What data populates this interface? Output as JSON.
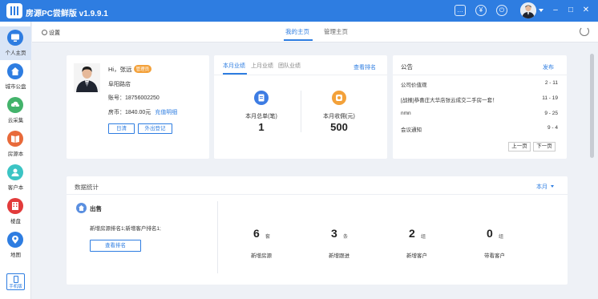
{
  "app": {
    "title": "房源PC尝鲜版 v1.9.9.1"
  },
  "sidebar": {
    "items": [
      {
        "label": "个人主页",
        "icon": "monitor-icon",
        "color": "#2e7de1"
      },
      {
        "label": "城市公盘",
        "icon": "house-icon",
        "color": "#2e7de1"
      },
      {
        "label": "云采集",
        "icon": "cloud-download-icon",
        "color": "#43b36b"
      },
      {
        "label": "房源本",
        "icon": "book-icon",
        "color": "#e86a3a"
      },
      {
        "label": "客户本",
        "icon": "person-icon",
        "color": "#3cc4c4"
      },
      {
        "label": "楼盘",
        "icon": "building-icon",
        "color": "#e23b3b"
      },
      {
        "label": "地图",
        "icon": "location-icon",
        "color": "#2e7de1"
      }
    ],
    "phone_label": "手机版"
  },
  "tabbar": {
    "settings": "设置",
    "tabs": [
      "我的主页",
      "管理主页"
    ],
    "active_tab": "我的主页"
  },
  "profile": {
    "greeting": "Hi，张远",
    "role_badge": "管理员",
    "store": "阜阳路店",
    "account": "账号：18756002250",
    "coins": "房币：1840.00元",
    "recharge": "充值明细",
    "buttons": [
      "日清",
      "外出登记"
    ]
  },
  "performance": {
    "tabs": [
      "本月业绩",
      "上月业绩",
      "团队业绩"
    ],
    "ranking_link": "查看排名",
    "stats": [
      {
        "label": "本月总单(笔)",
        "value": "1",
        "icon": "document-icon",
        "color": "#3d7ce3"
      },
      {
        "label": "本月收佣(元)",
        "value": "500",
        "icon": "money-icon",
        "color": "#f3a13a"
      }
    ]
  },
  "notices": {
    "title": "公告",
    "publish": "发布",
    "items": [
      {
        "text": "公司价值观",
        "date": "2 - 11"
      },
      {
        "text": "[战报]恭喜庄大华店张云成交二手房一套！",
        "date": "11 - 19"
      },
      {
        "text": "nmn",
        "date": "9 - 25"
      },
      {
        "text": "会议通知",
        "date": "9 - 4"
      }
    ],
    "prev": "上一页",
    "next": "下一页"
  },
  "stats": {
    "title": "数据统计",
    "period": "本月",
    "section_title": "出售",
    "ranking_text": "新增房源排名1;新增客户排名1;",
    "ranking_button": "查看排名",
    "metrics": [
      {
        "value": "6",
        "unit": "套",
        "label": "新增房源"
      },
      {
        "value": "3",
        "unit": "条",
        "label": "新增跟进"
      },
      {
        "value": "2",
        "unit": "组",
        "label": "新增客户"
      },
      {
        "value": "0",
        "unit": "组",
        "label": "带看客户"
      }
    ]
  },
  "colors": {
    "primary": "#2e7de1",
    "accent": "#f3a13a"
  }
}
